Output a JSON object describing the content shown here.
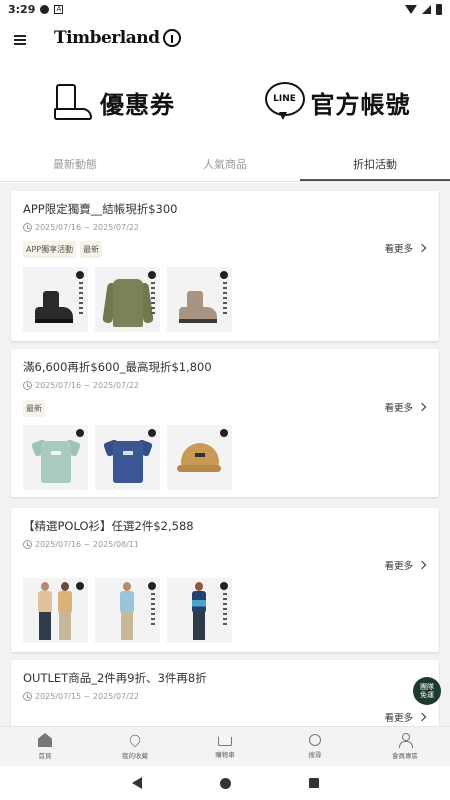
{
  "status_bar": {
    "time": "3:29"
  },
  "header": {
    "logo_text": "Timberland"
  },
  "banner": {
    "coupon_label": "優惠券",
    "line_label": "官方帳號",
    "line_badge": "LINE"
  },
  "tabs": [
    {
      "label": "最新動態"
    },
    {
      "label": "人氣商品"
    },
    {
      "label": "折扣活動"
    }
  ],
  "promos": [
    {
      "title": "APP限定獨賣__結帳現折$300",
      "date": "2025/07/16 ~ 2025/07/22",
      "tags": [
        "APP獨享活動",
        "最新"
      ],
      "more_label": "看更多"
    },
    {
      "title": "滿6,600再折$600_最高現折$1,800",
      "date": "2025/07/16 ~ 2025/07/22",
      "tags": [
        "最新"
      ],
      "more_label": "看更多"
    },
    {
      "title": "【精選POLO衫】任選2件$2,588",
      "date": "2025/07/16 ~ 2025/08/11",
      "tags": [],
      "more_label": "看更多"
    },
    {
      "title": "OUTLET商品_2件再9折、3件再8折",
      "date": "2025/07/15 ~ 2025/07/22",
      "tags": [],
      "more_label": "看更多"
    }
  ],
  "chat_fab": {
    "line1": "團隊",
    "line2": "免運"
  },
  "bottom_nav": [
    {
      "label": "首頁",
      "icon": "home-icon"
    },
    {
      "label": "我的收藏",
      "icon": "heart-icon"
    },
    {
      "label": "購物車",
      "icon": "cart-icon"
    },
    {
      "label": "搜尋",
      "icon": "search-icon"
    },
    {
      "label": "會員專區",
      "icon": "user-icon"
    }
  ],
  "colors": {
    "tag_bg": "#f6f3e6",
    "content_bg": "#f2f2f2",
    "fab_bg": "#1e3a2c"
  }
}
